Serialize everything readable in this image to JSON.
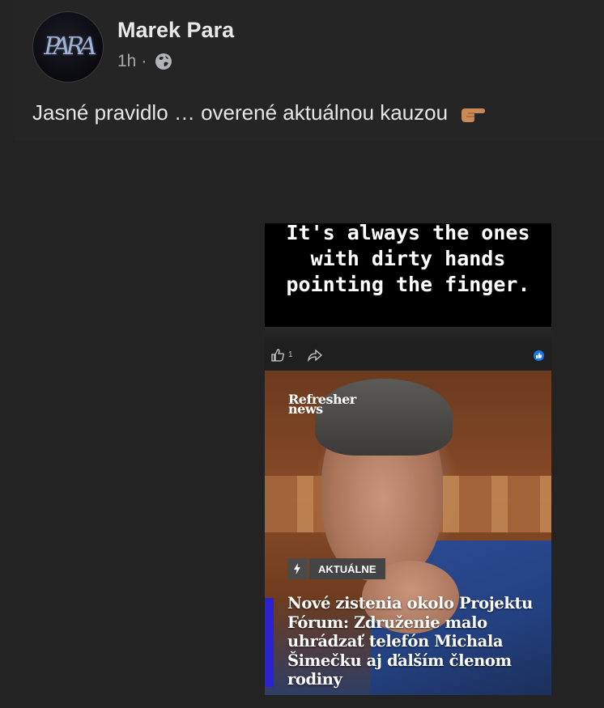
{
  "post": {
    "author": "Marek Para",
    "time": "1h",
    "separator": "·",
    "text": "Jasné pravidlo … overené aktuálnou kauzou",
    "avatar_text": "PARA"
  },
  "shared_image": {
    "quote_lines": [
      "It's always the ones",
      "with dirty hands",
      "pointing the finger."
    ],
    "like_count": "1",
    "news": {
      "logo_line1": "Refresher",
      "logo_line2": "news",
      "tag": "AKTUÁLNE",
      "headline": "Nové zistenia okolo Projektu Fórum: Združenie malo uhrádzať telefón Michala Šimečku aj ďalším členom rodiny"
    }
  },
  "colors": {
    "background": "#232323",
    "card": "#252526",
    "accent_bar": "#2b21d4",
    "badge": "#1877f2"
  },
  "icons": [
    "globe-icon",
    "backhand-index-pointing-right-icon",
    "like-icon",
    "share-icon",
    "like-badge-icon",
    "lightning-icon"
  ]
}
